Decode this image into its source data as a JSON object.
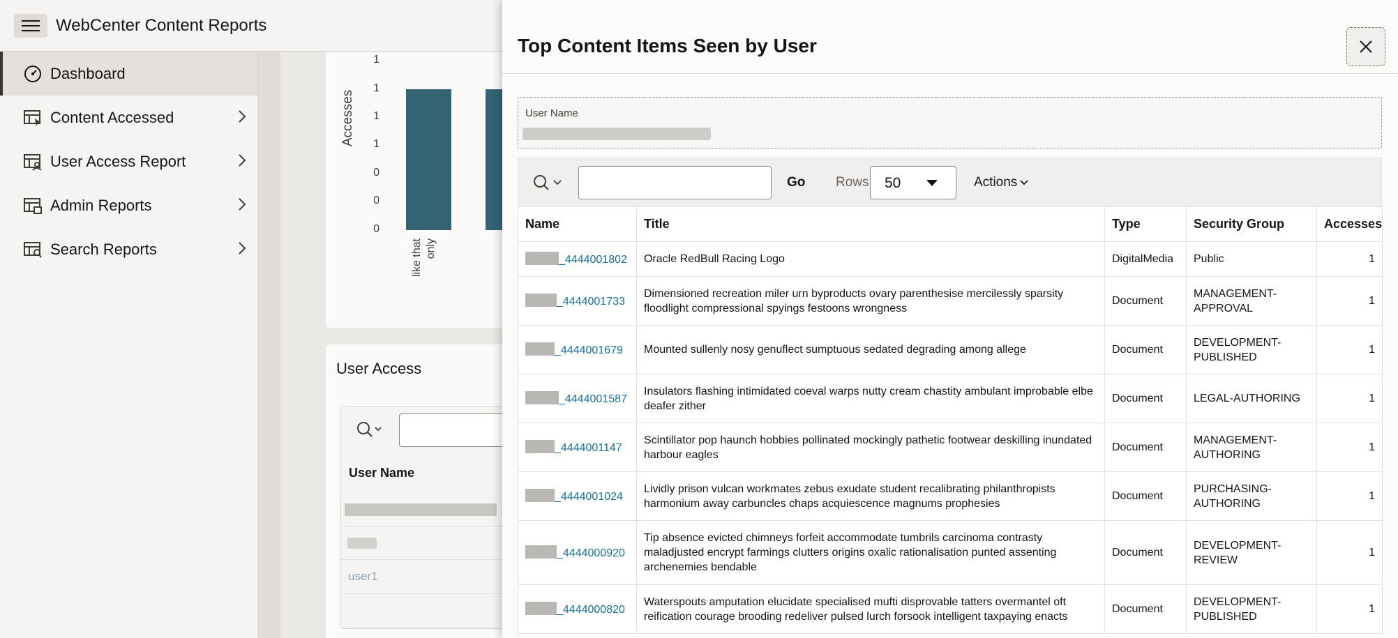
{
  "app": {
    "title": "WebCenter Content Reports"
  },
  "sidebar": {
    "items": [
      {
        "label": "Dashboard",
        "icon": "gauge-icon",
        "active": true
      },
      {
        "label": "Content Accessed",
        "icon": "report-grid-icon",
        "has_children": true
      },
      {
        "label": "User Access Report",
        "icon": "report-user-icon",
        "has_children": true
      },
      {
        "label": "Admin Reports",
        "icon": "report-admin-icon",
        "has_children": true
      },
      {
        "label": "Search Reports",
        "icon": "report-search-icon",
        "has_children": true
      }
    ]
  },
  "background": {
    "chart": {
      "ylabel": "Accesses",
      "yticks": [
        "1",
        "1",
        "1",
        "1",
        "0",
        "0",
        "0"
      ],
      "category": "like that only",
      "bar_color": "#346374"
    },
    "user_access": {
      "title": "User Access",
      "column": "User Name",
      "row_link": "user1"
    }
  },
  "drawer": {
    "title": "Top Content Items Seen by User",
    "user_name_label": "User Name",
    "toolbar": {
      "go_label": "Go",
      "rows_label": "Rows",
      "rows_value": "50",
      "actions_label": "Actions"
    },
    "table": {
      "columns": [
        "Name",
        "Title",
        "Type",
        "Security Group",
        "Accesses"
      ],
      "rows": [
        {
          "name": "_4444001802",
          "title": "Oracle RedBull Racing Logo",
          "type": "DigitalMedia",
          "group": "Public",
          "accesses": "1"
        },
        {
          "name": "_4444001733",
          "title": "Dimensioned recreation miler urn byproducts ovary parenthesise mercilessly sparsity floodlight compressional spyings festoons wrongness",
          "type": "Document",
          "group": "MANAGEMENT-APPROVAL",
          "accesses": "1"
        },
        {
          "name": "_4444001679",
          "title": "Mounted sullenly nosy genuflect sumptuous sedated degrading among allege",
          "type": "Document",
          "group": "DEVELOPMENT-PUBLISHED",
          "accesses": "1"
        },
        {
          "name": "_4444001587",
          "title": "Insulators flashing intimidated coeval warps nutty cream chastity ambulant improbable elbe deafer zither",
          "type": "Document",
          "group": "LEGAL-AUTHORING",
          "accesses": "1"
        },
        {
          "name": "_4444001147",
          "title": "Scintillator pop haunch hobbies pollinated mockingly pathetic footwear deskilling inundated harbour eagles",
          "type": "Document",
          "group": "MANAGEMENT-AUTHORING",
          "accesses": "1"
        },
        {
          "name": "_4444001024",
          "title": "Lividly prison vulcan workmates zebus exudate student recalibrating philanthropists harmonium away carbuncles chaps acquiescence magnums prophesies",
          "type": "Document",
          "group": "PURCHASING-AUTHORING",
          "accesses": "1"
        },
        {
          "name": "_4444000920",
          "title": "Tip absence evicted chimneys forfeit accommodate tumbrils carcinoma contrasty maladjusted encrypt farmings clutters origins oxalic rationalisation punted assenting archenemies bendable",
          "type": "Document",
          "group": "DEVELOPMENT-REVIEW",
          "accesses": "1"
        },
        {
          "name": "_4444000820",
          "title": "Waterspouts amputation elucidate specialised mufti disprovable tatters overmantel oft reification courage brooding redeliver pulsed lurch forsook intelligent taxpaying enacts",
          "type": "Document",
          "group": "DEVELOPMENT-PUBLISHED",
          "accesses": "1"
        }
      ]
    }
  }
}
